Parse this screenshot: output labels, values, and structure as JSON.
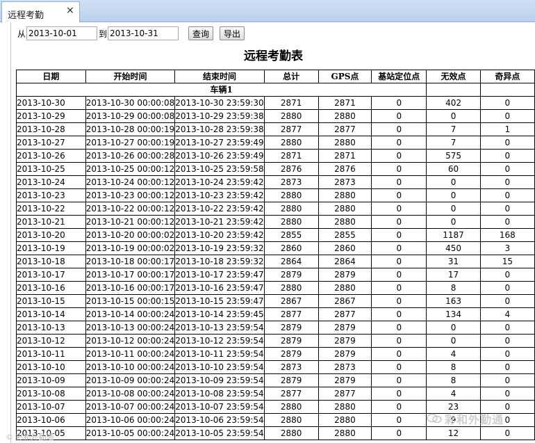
{
  "tab": {
    "title": "远程考勤"
  },
  "toolbar": {
    "from_label": "从",
    "from_value": "2013-10-01",
    "to_label": "到",
    "to_value": "2013-10-31",
    "query_label": "查询",
    "export_label": "导出"
  },
  "report": {
    "title": "远程考勤表",
    "columns": [
      "日期",
      "开始时间",
      "结束时间",
      "总计",
      "GPS点",
      "基站定位点",
      "无效点",
      "奇异点"
    ],
    "group_label": "车辆1",
    "rows": [
      [
        "2013-10-30",
        "2013-10-30 00:00:08",
        "2013-10-30 23:59:30",
        "2871",
        "2871",
        "0",
        "402",
        "0"
      ],
      [
        "2013-10-29",
        "2013-10-29 00:00:08",
        "2013-10-29 23:59:38",
        "2880",
        "2880",
        "0",
        "0",
        "0"
      ],
      [
        "2013-10-28",
        "2013-10-28 00:00:19",
        "2013-10-28 23:59:38",
        "2877",
        "2877",
        "0",
        "7",
        "1"
      ],
      [
        "2013-10-27",
        "2013-10-27 00:00:19",
        "2013-10-27 23:59:49",
        "2880",
        "2880",
        "0",
        "7",
        "0"
      ],
      [
        "2013-10-26",
        "2013-10-26 00:00:28",
        "2013-10-26 23:59:49",
        "2871",
        "2871",
        "0",
        "575",
        "0"
      ],
      [
        "2013-10-25",
        "2013-10-25 00:00:12",
        "2013-10-25 23:59:58",
        "2876",
        "2876",
        "0",
        "60",
        "0"
      ],
      [
        "2013-10-24",
        "2013-10-24 00:00:12",
        "2013-10-24 23:59:42",
        "2873",
        "2873",
        "0",
        "0",
        "0"
      ],
      [
        "2013-10-23",
        "2013-10-23 00:00:12",
        "2013-10-23 23:59:42",
        "2880",
        "2880",
        "0",
        "0",
        "0"
      ],
      [
        "2013-10-22",
        "2013-10-22 00:00:12",
        "2013-10-22 23:59:42",
        "2880",
        "2880",
        "0",
        "0",
        "0"
      ],
      [
        "2013-10-21",
        "2013-10-21 00:00:12",
        "2013-10-21 23:59:42",
        "2880",
        "2880",
        "0",
        "0",
        "0"
      ],
      [
        "2013-10-20",
        "2013-10-20 00:00:02",
        "2013-10-20 23:59:42",
        "2855",
        "2855",
        "0",
        "1187",
        "168"
      ],
      [
        "2013-10-19",
        "2013-10-19 00:00:02",
        "2013-10-19 23:59:32",
        "2860",
        "2860",
        "0",
        "450",
        "3"
      ],
      [
        "2013-10-18",
        "2013-10-18 00:00:17",
        "2013-10-18 23:59:32",
        "2864",
        "2864",
        "0",
        "31",
        "15"
      ],
      [
        "2013-10-17",
        "2013-10-17 00:00:17",
        "2013-10-17 23:59:47",
        "2879",
        "2879",
        "0",
        "17",
        "0"
      ],
      [
        "2013-10-16",
        "2013-10-16 00:00:17",
        "2013-10-16 23:59:47",
        "2880",
        "2880",
        "0",
        "8",
        "0"
      ],
      [
        "2013-10-15",
        "2013-10-15 00:00:15",
        "2013-10-15 23:59:47",
        "2867",
        "2867",
        "0",
        "163",
        "0"
      ],
      [
        "2013-10-14",
        "2013-10-14 00:00:24",
        "2013-10-14 23:59:45",
        "2877",
        "2877",
        "0",
        "134",
        "4"
      ],
      [
        "2013-10-13",
        "2013-10-13 00:00:24",
        "2013-10-13 23:59:54",
        "2879",
        "2879",
        "0",
        "0",
        "0"
      ],
      [
        "2013-10-12",
        "2013-10-12 00:00:24",
        "2013-10-12 23:59:54",
        "2879",
        "2879",
        "0",
        "0",
        "0"
      ],
      [
        "2013-10-11",
        "2013-10-11 00:00:24",
        "2013-10-11 23:59:54",
        "2879",
        "2879",
        "0",
        "4",
        "0"
      ],
      [
        "2013-10-10",
        "2013-10-10 00:00:24",
        "2013-10-10 23:59:54",
        "2873",
        "2873",
        "0",
        "8",
        "0"
      ],
      [
        "2013-10-09",
        "2013-10-09 00:00:24",
        "2013-10-09 23:59:54",
        "2879",
        "2879",
        "0",
        "8",
        "0"
      ],
      [
        "2013-10-08",
        "2013-10-08 00:00:24",
        "2013-10-08 23:59:54",
        "2877",
        "2877",
        "0",
        "4",
        "0"
      ],
      [
        "2013-10-07",
        "2013-10-07 00:00:24",
        "2013-10-07 23:59:54",
        "2880",
        "2880",
        "0",
        "23",
        "0"
      ],
      [
        "2013-10-06",
        "2013-10-06 00:00:24",
        "2013-10-06 23:59:54",
        "2880",
        "2880",
        "0",
        "9",
        "0"
      ],
      [
        "2013-10-05",
        "2013-10-05 00:00:24",
        "2013-10-05 23:59:54",
        "2880",
        "2880",
        "0",
        "12",
        "0"
      ]
    ]
  },
  "watermarks": {
    "right_text": "彩和外勤通",
    "left_text": "© 彩和外勤通"
  },
  "colors": {
    "tab_bar": "#b9d0ec",
    "border": "#000000",
    "watermark": "#cfcfcf"
  }
}
